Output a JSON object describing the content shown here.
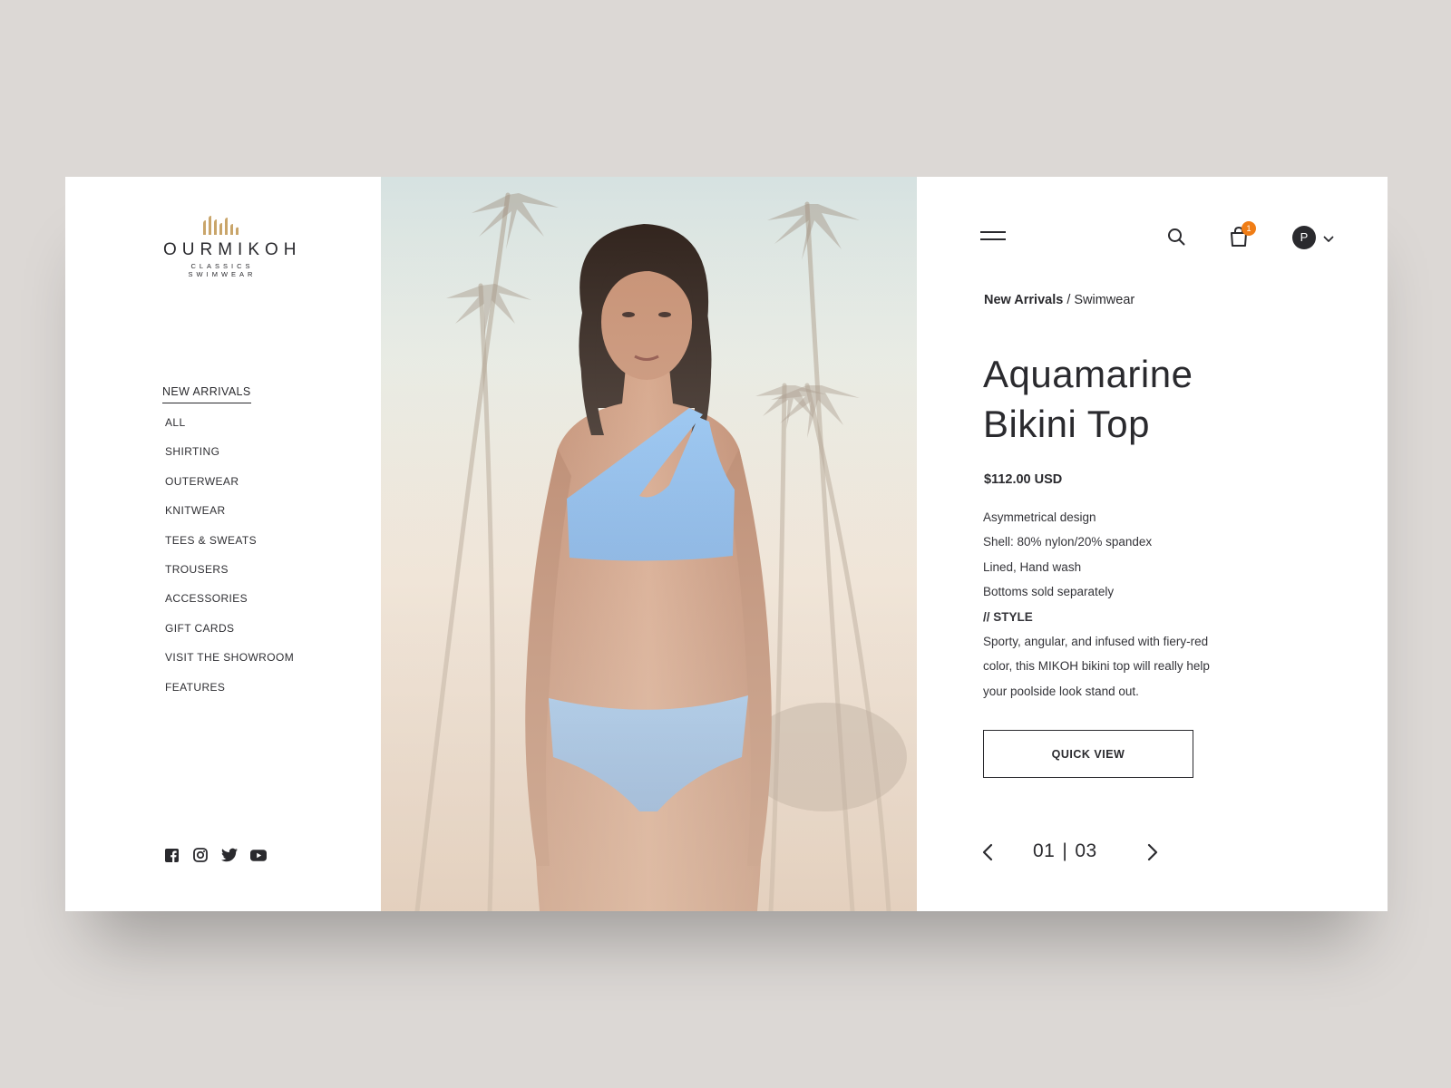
{
  "brand": {
    "name": "OURMIKOH",
    "tagline": "CLASSICS SWIMWEAR",
    "accent_color": "#c9a56a"
  },
  "nav": {
    "title": "NEW ARRIVALS",
    "items": [
      "ALL",
      "SHIRTING",
      "OUTERWEAR",
      "KNITWEAR",
      "TEES & SWEATS",
      "TROUSERS",
      "ACCESSORIES",
      "GIFT CARDS",
      "VISIT THE SHOWROOM",
      "FEATURES"
    ]
  },
  "social": [
    "facebook-icon",
    "instagram-icon",
    "twitter-icon",
    "youtube-icon"
  ],
  "header": {
    "cart_count": "1",
    "cart_badge_color": "#f07d16",
    "avatar_initial": "P"
  },
  "breadcrumb": {
    "current": "New Arrivals",
    "separator": "/",
    "category": "Swimwear"
  },
  "product": {
    "title_line1": "Aquamarine",
    "title_line2": "Bikini Top",
    "price": "$112.00 USD",
    "features": [
      "Asymmetrical design",
      "Shell: 80% nylon/20% spandex",
      "Lined, Hand wash",
      "Bottoms sold separately"
    ],
    "style_heading": "// STYLE",
    "style_text_lines": [
      "Sporty, angular, and infused with fiery-red",
      "color, this MIKOH bikini top will really help",
      "your poolside look stand out."
    ],
    "swimsuit_color": "#7fb6ee"
  },
  "actions": {
    "quick_view": "QUICK VIEW"
  },
  "pager": {
    "current": "01",
    "divider": "|",
    "total": "03"
  }
}
